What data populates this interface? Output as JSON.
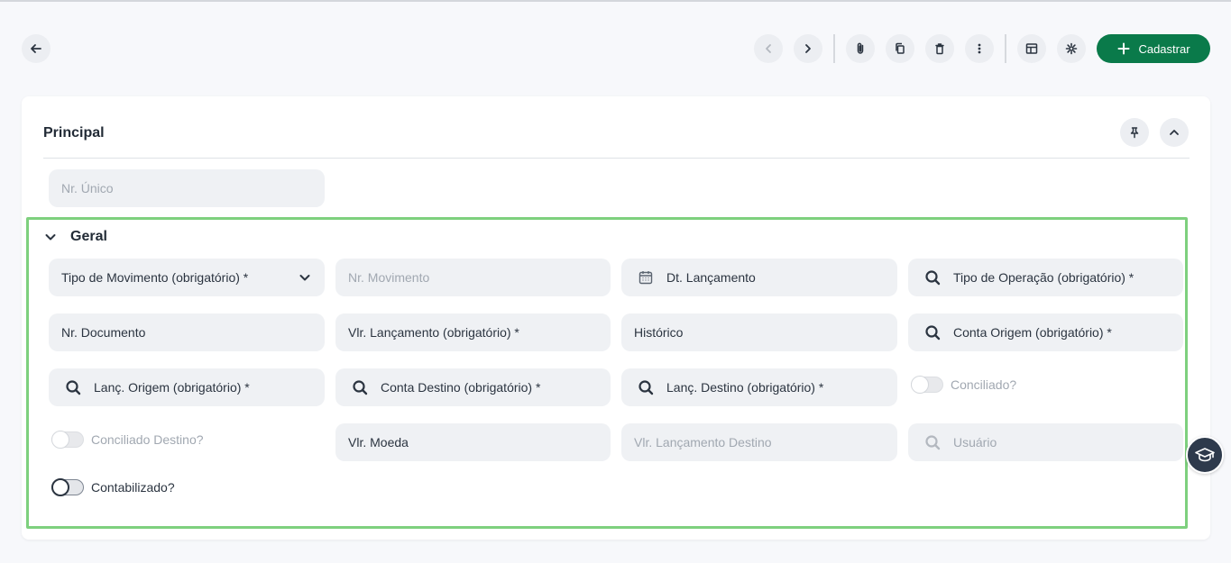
{
  "toolbar": {
    "back_icon": "arrow-left-icon",
    "prev_icon": "chevron-left-icon",
    "next_icon": "chevron-right-icon",
    "attach_icon": "paperclip-icon",
    "copy_icon": "copy-icon",
    "delete_icon": "trash-icon",
    "more_icon": "more-vertical-icon",
    "layout_icon": "layout-icon",
    "settings_icon": "gear-icon",
    "create_label": "Cadastrar",
    "create_color": "#0a7a4a"
  },
  "principal": {
    "title": "Principal",
    "pin_icon": "pin-icon",
    "collapse_icon": "chevron-up-icon",
    "nr_unico": {
      "placeholder": "Nr. Único"
    }
  },
  "geral": {
    "title": "Geral",
    "highlight_color": "#7ed07e",
    "fields": {
      "tipo_movimento": "Tipo de Movimento (obrigatório) *",
      "nr_movimento": "Nr. Movimento",
      "dt_lancamento": "Dt. Lançamento",
      "tipo_operacao": "Tipo de Operação (obrigatório) *",
      "nr_documento": "Nr. Documento",
      "vlr_lancamento": "Vlr. Lançamento (obrigatório) *",
      "historico": "Histórico",
      "conta_origem": "Conta Origem (obrigatório) *",
      "lanc_origem": "Lanç. Origem (obrigatório) *",
      "conta_destino": "Conta Destino (obrigatório) *",
      "lanc_destino": "Lanç. Destino (obrigatório) *",
      "vlr_moeda": "Vlr. Moeda",
      "vlr_lancamento_destino": "Vlr. Lançamento Destino",
      "usuario": "Usuário"
    },
    "toggles": {
      "conciliado": "Conciliado?",
      "conciliado_destino": "Conciliado Destino?",
      "contabilizado": "Contabilizado?"
    }
  },
  "help_fab_icon": "graduation-cap-icon"
}
